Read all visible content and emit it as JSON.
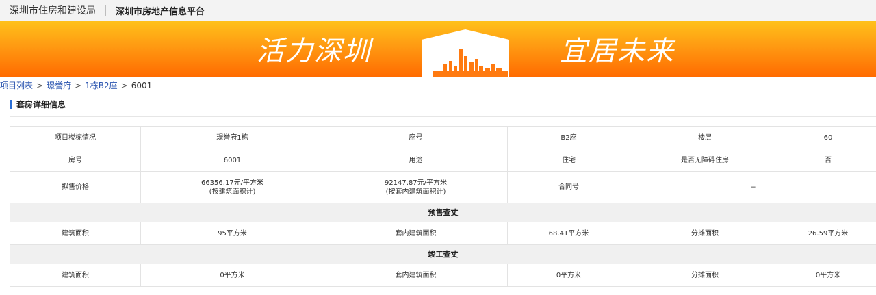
{
  "header": {
    "department": "深圳市住房和建设局",
    "platform": "深圳市房地产信息平台"
  },
  "banner": {
    "slogan_left": "活力深圳",
    "slogan_right": "宜居未来",
    "skyline_icon": "city-skyline-icon"
  },
  "breadcrumb": {
    "items": [
      "项目列表",
      "璟誉府",
      "1栋B2座"
    ],
    "current": "6001",
    "separator": ">"
  },
  "section": {
    "title": "套房详细信息"
  },
  "table": {
    "row1": {
      "label1": "项目楼栋情况",
      "value1": "璟誉府1栋",
      "label2": "座号",
      "value2": "B2座",
      "label3": "楼层",
      "value3": "60"
    },
    "row2": {
      "label1": "房号",
      "value1": "6001",
      "label2": "用途",
      "value2": "住宅",
      "label3": "是否无障碍住房",
      "value3": "否"
    },
    "row3": {
      "label1": "拟售价格",
      "price1": "66356.17元/平方米",
      "price1_note": "(按建筑面积计)",
      "price2": "92147.87元/平方米",
      "price2_note": "(按套内建筑面积计)",
      "label2": "合同号",
      "value2": "--"
    },
    "presale_title": "预售查丈",
    "presale": {
      "label1": "建筑面积",
      "value1": "95平方米",
      "label2": "套内建筑面积",
      "value2": "68.41平方米",
      "label3": "分摊面积",
      "value3": "26.59平方米"
    },
    "completion_title": "竣工查丈",
    "completion": {
      "label1": "建筑面积",
      "value1": "0平方米",
      "label2": "套内建筑面积",
      "value2": "0平方米",
      "label3": "分摊面积",
      "value3": "0平方米"
    }
  }
}
